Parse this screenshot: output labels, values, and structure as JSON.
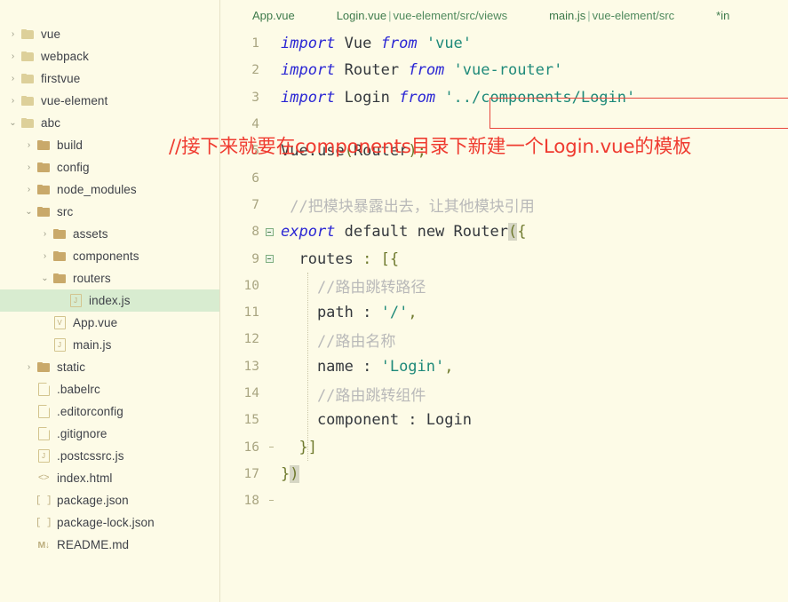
{
  "sidebar": {
    "tree": [
      {
        "label": "vue",
        "depth": 0,
        "chevron": "›",
        "icon": "folder-open-top",
        "selected": false
      },
      {
        "label": "webpack",
        "depth": 0,
        "chevron": "›",
        "icon": "folder-open-top",
        "selected": false
      },
      {
        "label": "firstvue",
        "depth": 0,
        "chevron": "›",
        "icon": "folder-open-top",
        "selected": false
      },
      {
        "label": "vue-element",
        "depth": 0,
        "chevron": "›",
        "icon": "folder-open-top",
        "selected": false
      },
      {
        "label": "abc",
        "depth": 0,
        "chevron": "⌄",
        "icon": "folder-open-top",
        "selected": false
      },
      {
        "label": "build",
        "depth": 1,
        "chevron": "›",
        "icon": "folder-solid",
        "selected": false
      },
      {
        "label": "config",
        "depth": 1,
        "chevron": "›",
        "icon": "folder-solid",
        "selected": false
      },
      {
        "label": "node_modules",
        "depth": 1,
        "chevron": "›",
        "icon": "folder-solid",
        "selected": false
      },
      {
        "label": "src",
        "depth": 1,
        "chevron": "⌄",
        "icon": "folder-solid",
        "selected": false
      },
      {
        "label": "assets",
        "depth": 2,
        "chevron": "›",
        "icon": "folder-solid",
        "selected": false
      },
      {
        "label": "components",
        "depth": 2,
        "chevron": "›",
        "icon": "folder-solid",
        "selected": false
      },
      {
        "label": "routers",
        "depth": 2,
        "chevron": "⌄",
        "icon": "folder-solid",
        "selected": false
      },
      {
        "label": "index.js",
        "depth": 3,
        "chevron": "",
        "icon": "file-js",
        "selected": true
      },
      {
        "label": "App.vue",
        "depth": 2,
        "chevron": "",
        "icon": "file-vue",
        "selected": false
      },
      {
        "label": "main.js",
        "depth": 2,
        "chevron": "",
        "icon": "file-js",
        "selected": false
      },
      {
        "label": "static",
        "depth": 1,
        "chevron": "›",
        "icon": "folder-solid",
        "selected": false
      },
      {
        "label": ".babelrc",
        "depth": 1,
        "chevron": "",
        "icon": "file-plain",
        "selected": false
      },
      {
        "label": ".editorconfig",
        "depth": 1,
        "chevron": "",
        "icon": "file-plain",
        "selected": false
      },
      {
        "label": ".gitignore",
        "depth": 1,
        "chevron": "",
        "icon": "file-plain",
        "selected": false
      },
      {
        "label": ".postcssrc.js",
        "depth": 1,
        "chevron": "",
        "icon": "file-js",
        "selected": false
      },
      {
        "label": "index.html",
        "depth": 1,
        "chevron": "",
        "icon": "file-html",
        "selected": false
      },
      {
        "label": "package.json",
        "depth": 1,
        "chevron": "",
        "icon": "file-json",
        "selected": false
      },
      {
        "label": "package-lock.json",
        "depth": 1,
        "chevron": "",
        "icon": "file-json",
        "selected": false
      },
      {
        "label": "README.md",
        "depth": 1,
        "chevron": "",
        "icon": "file-md",
        "selected": false
      }
    ]
  },
  "editor": {
    "tabs": [
      {
        "name": "App.vue",
        "path": ""
      },
      {
        "name": "Login.vue",
        "path": "vue-element/src/views"
      },
      {
        "name": "main.js",
        "path": "vue-element/src"
      },
      {
        "name": "*in",
        "path": ""
      }
    ],
    "lines": [
      {
        "num": "1",
        "fold": "",
        "tokens": [
          {
            "t": "import",
            "c": "kw"
          },
          {
            "t": " ",
            "c": "id"
          },
          {
            "t": "Vue",
            "c": "id"
          },
          {
            "t": " ",
            "c": "id"
          },
          {
            "t": "from",
            "c": "kw"
          },
          {
            "t": " ",
            "c": "id"
          },
          {
            "t": "'vue'",
            "c": "str"
          }
        ]
      },
      {
        "num": "2",
        "fold": "",
        "tokens": [
          {
            "t": "import",
            "c": "kw"
          },
          {
            "t": " ",
            "c": "id"
          },
          {
            "t": "Router",
            "c": "id"
          },
          {
            "t": " ",
            "c": "id"
          },
          {
            "t": "from",
            "c": "kw"
          },
          {
            "t": " ",
            "c": "id"
          },
          {
            "t": "'vue-router'",
            "c": "str"
          }
        ]
      },
      {
        "num": "3",
        "fold": "",
        "tokens": [
          {
            "t": "import",
            "c": "kw"
          },
          {
            "t": " ",
            "c": "id"
          },
          {
            "t": "Login",
            "c": "id"
          },
          {
            "t": " ",
            "c": "id"
          },
          {
            "t": "from",
            "c": "kw"
          },
          {
            "t": " ",
            "c": "id"
          },
          {
            "t": "'../components/Login'",
            "c": "str"
          }
        ]
      },
      {
        "num": "4",
        "fold": "",
        "tokens": []
      },
      {
        "num": "5",
        "fold": "",
        "tokens": [
          {
            "t": "Vue",
            "c": "id"
          },
          {
            "t": ".",
            "c": "dot"
          },
          {
            "t": "use",
            "c": "fn"
          },
          {
            "t": "(",
            "c": "punc"
          },
          {
            "t": "Router",
            "c": "id"
          },
          {
            "t": ")",
            "c": "punc"
          },
          {
            "t": ";",
            "c": "punc"
          }
        ]
      },
      {
        "num": "6",
        "fold": "",
        "tokens": []
      },
      {
        "num": "7",
        "fold": "",
        "tokens": [
          {
            "t": " //把模块暴露出去，让其他模块引用",
            "c": "cmt"
          }
        ]
      },
      {
        "num": "8",
        "fold": "box",
        "tokens": [
          {
            "t": "export",
            "c": "kw"
          },
          {
            "t": " ",
            "c": "id"
          },
          {
            "t": "default",
            "c": "id"
          },
          {
            "t": " ",
            "c": "id"
          },
          {
            "t": "new",
            "c": "id"
          },
          {
            "t": " ",
            "c": "id"
          },
          {
            "t": "Router",
            "c": "id"
          },
          {
            "t": "(",
            "c": "brk"
          },
          {
            "t": "{",
            "c": "punc"
          }
        ]
      },
      {
        "num": "9",
        "fold": "box",
        "tokens": [
          {
            "t": "  routes : [{",
            "c": "punc-mix"
          }
        ]
      },
      {
        "num": "10",
        "fold": "line",
        "tokens": [
          {
            "t": "    //路由跳转路径",
            "c": "cmt"
          }
        ]
      },
      {
        "num": "11",
        "fold": "line",
        "tokens": [
          {
            "t": "    path : ",
            "c": "id"
          },
          {
            "t": "'/'",
            "c": "str"
          },
          {
            "t": ",",
            "c": "punc"
          }
        ]
      },
      {
        "num": "12",
        "fold": "line",
        "tokens": [
          {
            "t": "    //路由名称",
            "c": "cmt"
          }
        ]
      },
      {
        "num": "13",
        "fold": "line",
        "tokens": [
          {
            "t": "    name : ",
            "c": "id"
          },
          {
            "t": "'Login'",
            "c": "str"
          },
          {
            "t": ",",
            "c": "punc"
          }
        ]
      },
      {
        "num": "14",
        "fold": "line",
        "tokens": [
          {
            "t": "    //路由跳转组件",
            "c": "cmt"
          }
        ]
      },
      {
        "num": "15",
        "fold": "line",
        "tokens": [
          {
            "t": "    component : Login",
            "c": "id"
          }
        ]
      },
      {
        "num": "16",
        "fold": "capline",
        "tokens": [
          {
            "t": "  }]",
            "c": "punc"
          }
        ]
      },
      {
        "num": "17",
        "fold": "line",
        "tokens": [
          {
            "t": "}",
            "c": "punc"
          },
          {
            "t": ")",
            "c": "brk"
          }
        ]
      },
      {
        "num": "18",
        "fold": "capline",
        "tokens": []
      }
    ]
  },
  "annotation": {
    "text": "//接下来就要在components目录下新建一个Login.vue的模板",
    "color": "#ef3b30",
    "box_color": "#e8453c"
  },
  "theme": {
    "background": "#fdfbe7",
    "selection": "#d8ecd0",
    "keyword": "#2b27d4",
    "string": "#1f8a7a",
    "comment": "#b9b9b9",
    "punctuation": "#6f7a2e",
    "tab_text": "#3d7a4b",
    "gutter": "#a9a581"
  }
}
